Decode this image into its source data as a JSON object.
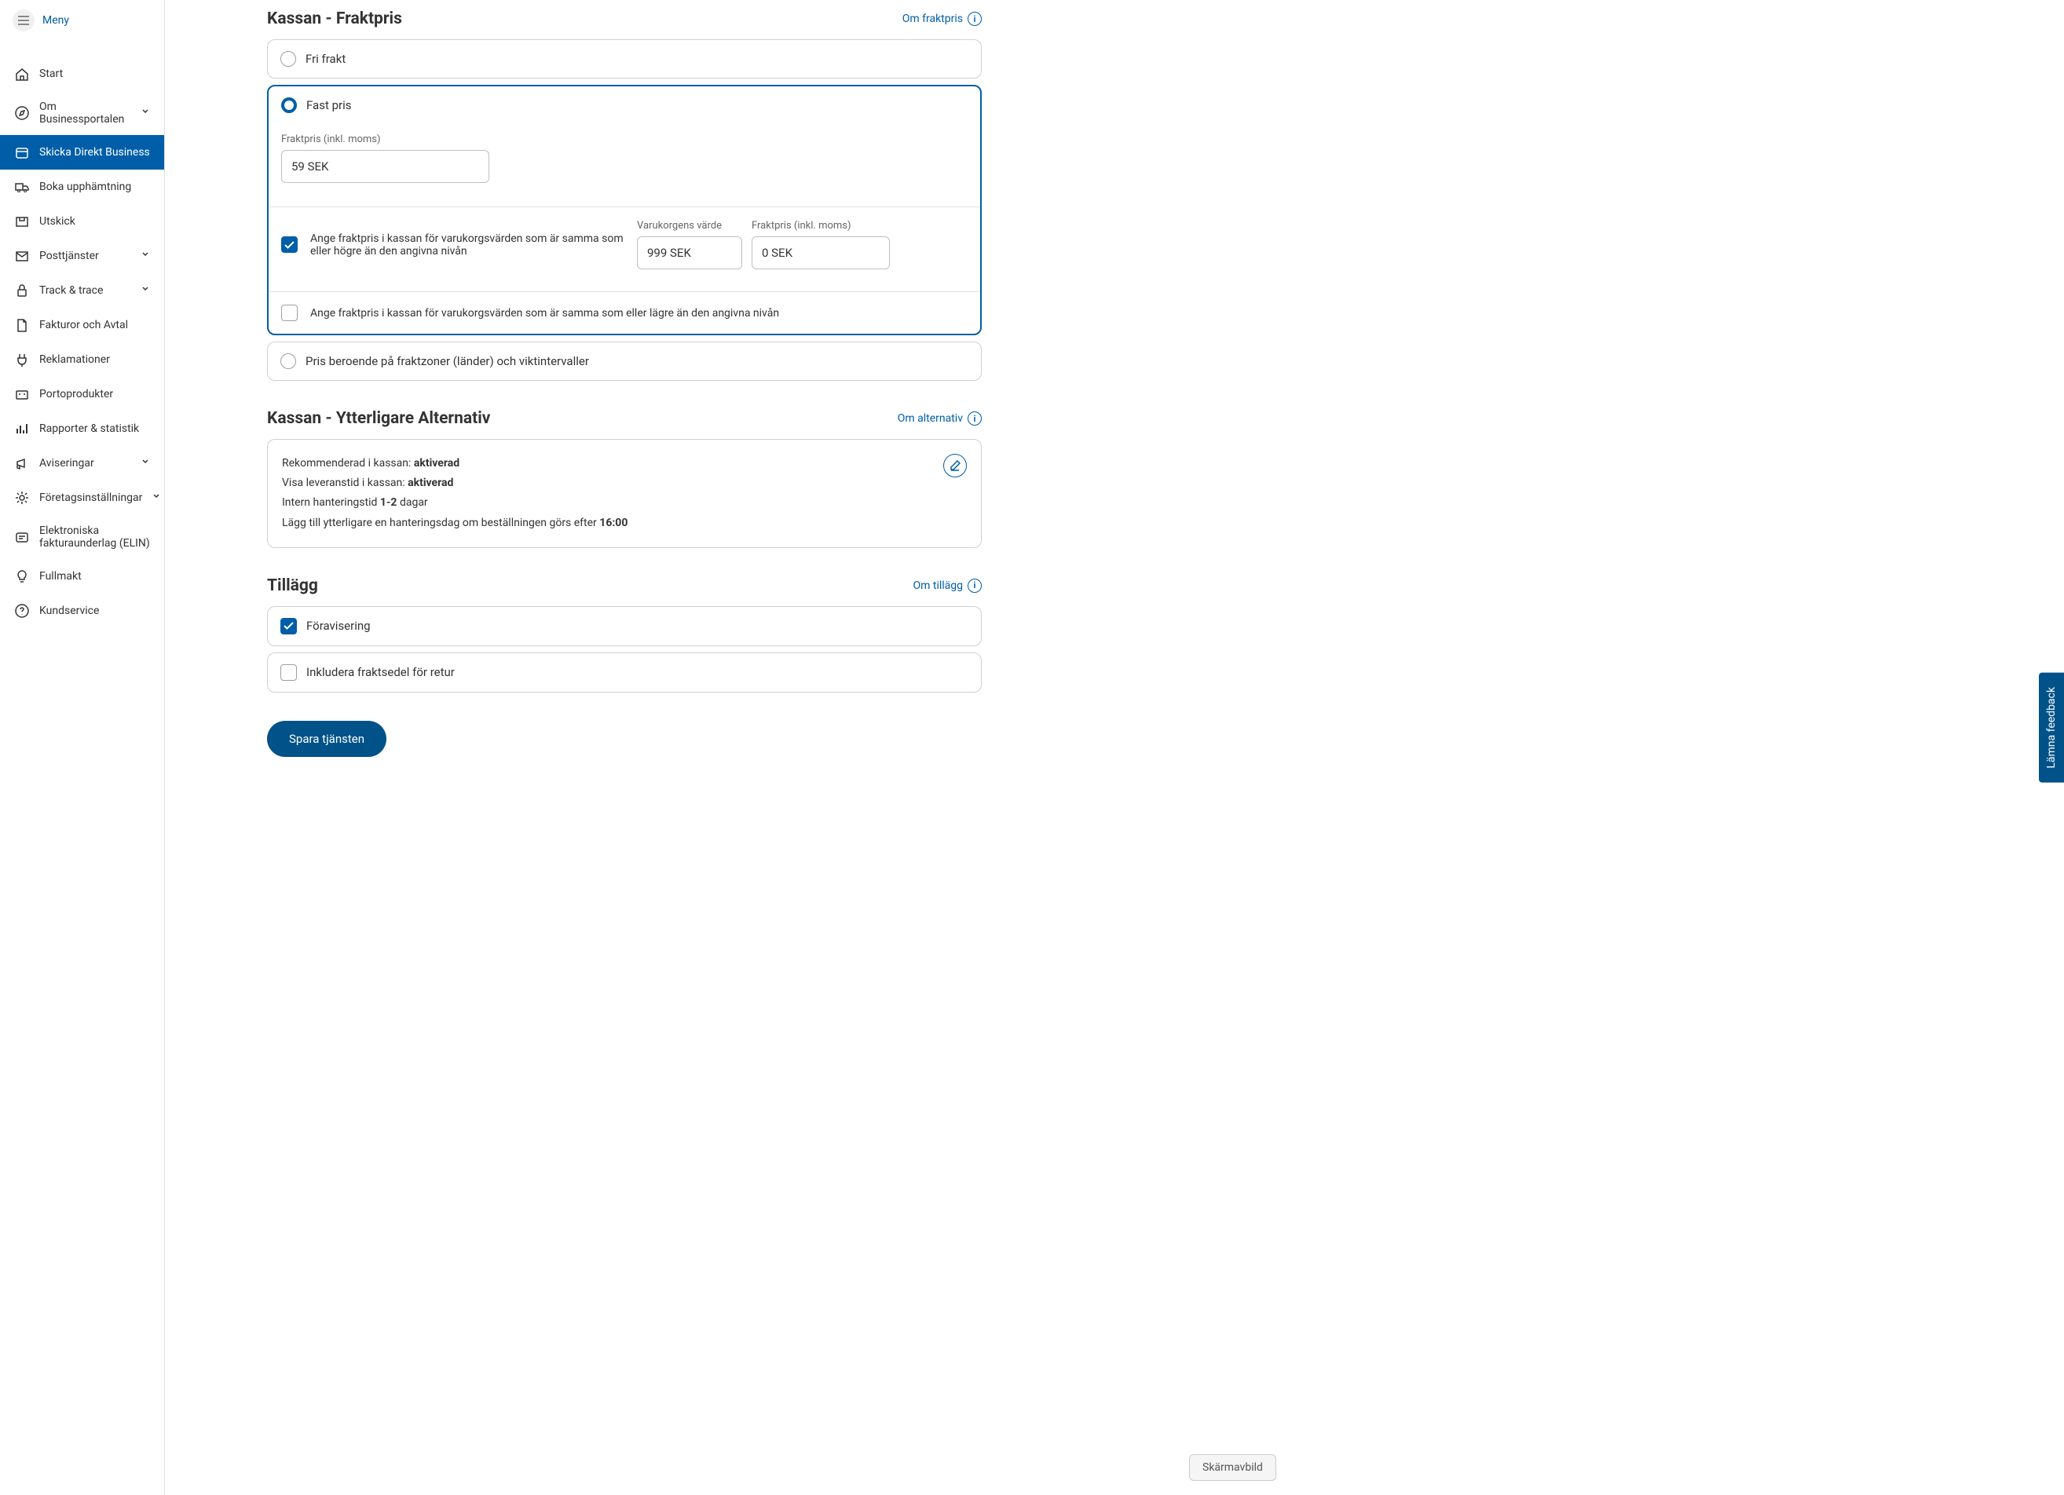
{
  "sidebar": {
    "menu_toggle": "Meny",
    "items": [
      {
        "label": "Start",
        "icon": "home"
      },
      {
        "label": "Om Businessportalen",
        "icon": "compass",
        "expandable": true
      },
      {
        "label": "Skicka Direkt Business",
        "icon": "package",
        "active": true
      },
      {
        "label": "Boka upphämtning",
        "icon": "truck"
      },
      {
        "label": "Utskick",
        "icon": "mail"
      },
      {
        "label": "Posttjänster",
        "icon": "envelope",
        "expandable": true
      },
      {
        "label": "Track & trace",
        "icon": "lock",
        "expandable": true
      },
      {
        "label": "Fakturor och Avtal",
        "icon": "document"
      },
      {
        "label": "Reklamationer",
        "icon": "plug"
      },
      {
        "label": "Portoprodukter",
        "icon": "cart"
      },
      {
        "label": "Rapporter & statistik",
        "icon": "bars"
      },
      {
        "label": "Aviseringar",
        "icon": "megaphone",
        "expandable": true
      },
      {
        "label": "Företagsinställningar",
        "icon": "gear",
        "expandable": true
      },
      {
        "label": "Elektroniska fakturaunderlag (ELIN)",
        "icon": "elin"
      },
      {
        "label": "Fullmakt",
        "icon": "bulb"
      },
      {
        "label": "Kundservice",
        "icon": "question"
      }
    ]
  },
  "sections": {
    "shipping": {
      "title": "Kassan - Fraktpris",
      "info_link": "Om fraktpris",
      "options": {
        "free": "Fri frakt",
        "fixed": "Fast pris",
        "zones": "Pris beroende på fraktzoner (länder) och viktintervaller"
      },
      "fixed_price": {
        "label": "Fraktpris (inkl. moms)",
        "value": "59 SEK"
      },
      "higher_threshold": {
        "text": "Ange fraktpris i kassan för varukorgsvärden som är samma som eller högre än den angivna nivån",
        "cart_label": "Varukorgens värde",
        "cart_value": "999 SEK",
        "price_label": "Fraktpris (inkl. moms)",
        "price_value": "0 SEK"
      },
      "lower_threshold": {
        "text": "Ange fraktpris i kassan för varukorgsvärden som är samma som eller lägre än den angivna nivån"
      }
    },
    "alternatives": {
      "title": "Kassan - Ytterligare Alternativ",
      "info_link": "Om alternativ",
      "lines": {
        "recommended_prefix": "Rekommenderad i kassan: ",
        "recommended_value": "aktiverad",
        "delivery_prefix": "Visa leveranstid i kassan: ",
        "delivery_value": "aktiverad",
        "handling_prefix": "Intern hanteringstid ",
        "handling_value": "1-2",
        "handling_suffix": " dagar",
        "extra_prefix": "Lägg till ytterligare en hanteringsdag om beställningen görs efter ",
        "extra_value": "16:00"
      }
    },
    "addons": {
      "title": "Tillägg",
      "info_link": "Om tillägg",
      "preadvice": "Föravisering",
      "return": "Inkludera fraktsedel för retur"
    }
  },
  "buttons": {
    "save": "Spara tjänsten"
  },
  "feedback": "Lämna feedback",
  "screenshot": "Skärmavbild"
}
